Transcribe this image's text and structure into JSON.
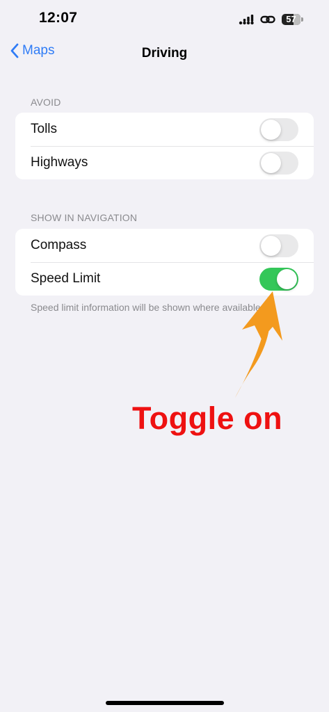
{
  "status_bar": {
    "time": "12:07",
    "battery": "57",
    "icons": [
      "signal-icon",
      "hotspot-icon",
      "battery-icon"
    ]
  },
  "nav": {
    "back_label": "Maps",
    "title": "Driving"
  },
  "sections": [
    {
      "header": "AVOID",
      "rows": [
        {
          "label": "Tolls",
          "toggle_on": false
        },
        {
          "label": "Highways",
          "toggle_on": false
        }
      ]
    },
    {
      "header": "SHOW IN NAVIGATION",
      "rows": [
        {
          "label": "Compass",
          "toggle_on": false
        },
        {
          "label": "Speed Limit",
          "toggle_on": true
        }
      ],
      "footer": "Speed limit information will be shown where available."
    }
  ],
  "annotation": {
    "text": "Toggle on",
    "text_color": "#ee1111",
    "arrow_color": "#f39a1e"
  },
  "colors": {
    "accent": "#2f7cf6",
    "toggle_on": "#34c759",
    "toggle_off": "#e9e9ea",
    "background": "#f2f1f6"
  }
}
